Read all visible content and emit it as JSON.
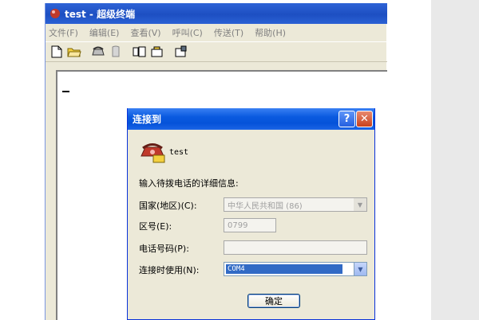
{
  "window": {
    "title": "test - 超级终端",
    "menu": [
      "文件(F)",
      "编辑(E)",
      "查看(V)",
      "呼叫(C)",
      "传送(T)",
      "帮助(H)"
    ],
    "toolbar_icons": [
      "new-icon",
      "open-icon",
      "dial-icon",
      "disconnect-icon",
      "send-icon",
      "receive-icon",
      "properties-icon"
    ]
  },
  "dialog": {
    "title": "连接到",
    "help_label": "?",
    "close_label": "✕",
    "connection_name": "test",
    "instructions": "输入待拨电话的详细信息:",
    "country_label": "国家(地区)(C):",
    "country_value": "中华人民共和国 (86)",
    "area_code_label": "区号(E):",
    "area_code_value": "0799",
    "phone_label": "电话号码(P):",
    "phone_value": "",
    "connect_using_label": "连接时使用(N):",
    "connect_using_value": "COM4",
    "ok_label": "确定"
  }
}
